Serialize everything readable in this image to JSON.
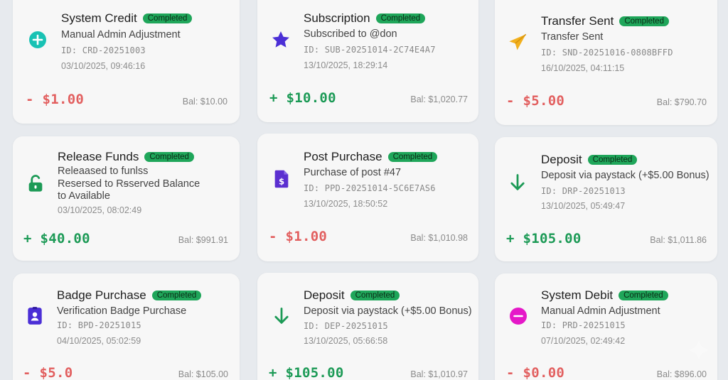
{
  "colors": {
    "page_bg": "#e7eaee",
    "card_bg": "#f7f7f7",
    "badge_green": "#1fa65a",
    "credit_green": "#1c9a56",
    "debit_red": "#e25f5f",
    "icon_teal": "#19c2b4",
    "icon_indigo": "#4b2fd6",
    "icon_yellow": "#f2b01e",
    "icon_green": "#1c9a56",
    "icon_purple": "#5b2fd0",
    "icon_pink": "#e518c8"
  },
  "transactions": [
    {
      "title": "System Credit",
      "status": "Completed",
      "description": "Manual Admin Adjustment",
      "id": "ID: CRD-20251003",
      "date": "03/10/2025, 09:46:16",
      "amount": "- $1.00",
      "balance": "Bal: $10.00",
      "icon": "plus-circle-icon"
    },
    {
      "title": "Subscription",
      "status": "Completed",
      "description": "Subscribed to @don",
      "id": "ID: SUB-20251014-2C74E4A7",
      "date": "13/10/2025, 18:29:14",
      "amount": "+ $10.00",
      "balance": "Bal: $1,020.77",
      "icon": "star-icon"
    },
    {
      "title": "Transfer Sent",
      "status": "Completed",
      "description": "Transfer Sent",
      "id": "ID: SND-20251016-0808BFFD",
      "date": "16/10/2025, 04:11:15",
      "amount": "- $5.00",
      "balance": "Bal: $790.70",
      "icon": "paper-plane-icon"
    },
    {
      "title": "Release Funds",
      "status": "Completed",
      "description": "Releaased to funlss\nResersed to Rꞩserved Balance\nto Available",
      "id": "",
      "date": "03/10/2025, 08:02:49",
      "amount": "+ $40.00",
      "balance": "Bal: $991.91",
      "icon": "unlock-icon"
    },
    {
      "title": "Post Purchase",
      "status": "Completed",
      "description": "Purchase of post #47",
      "id": "ID: PPD-20251014-5C6E7AS6",
      "date": "13/10/2025, 18:50:52",
      "amount": "- $1.00",
      "balance": "Bal: $1,010.98",
      "icon": "dollar-document-icon"
    },
    {
      "title": "Deposit",
      "status": "Completed",
      "description": "Deposit via paystack (+$5.00 Bonus)",
      "id": "ID: DRP-20251013",
      "date": "13/10/2025, 05:49:47",
      "amount": "+ $105.00",
      "balance": "Bal: $1,011.86",
      "icon": "arrow-down-icon"
    },
    {
      "title": "Badge Purchase",
      "status": "Completed",
      "description": "Verification Badge Purchase",
      "id": "ID: BPD-20251015",
      "date": "04/10/2025, 05:02:59",
      "amount": "- $5.0",
      "balance": "Bal: $105.00",
      "icon": "id-badge-icon"
    },
    {
      "title": "Deposit",
      "status": "Completed",
      "description": "Deposit via paystack (+$5.00 Bonus)",
      "id": "ID: DEP-20251015",
      "date": "13/10/2025, 05:66:58",
      "amount": "+ $105.00",
      "balance": "Bal: $1,010.97",
      "icon": "arrow-down-icon"
    },
    {
      "title": "System Debit",
      "status": "Completed",
      "description": "Manual Admin Adjustment",
      "id": "ID: PRD-20251015",
      "date": "07/10/2025, 02:49:42",
      "amount": "- $0.00",
      "balance": "Bal: $896.00",
      "icon": "minus-circle-icon"
    }
  ]
}
